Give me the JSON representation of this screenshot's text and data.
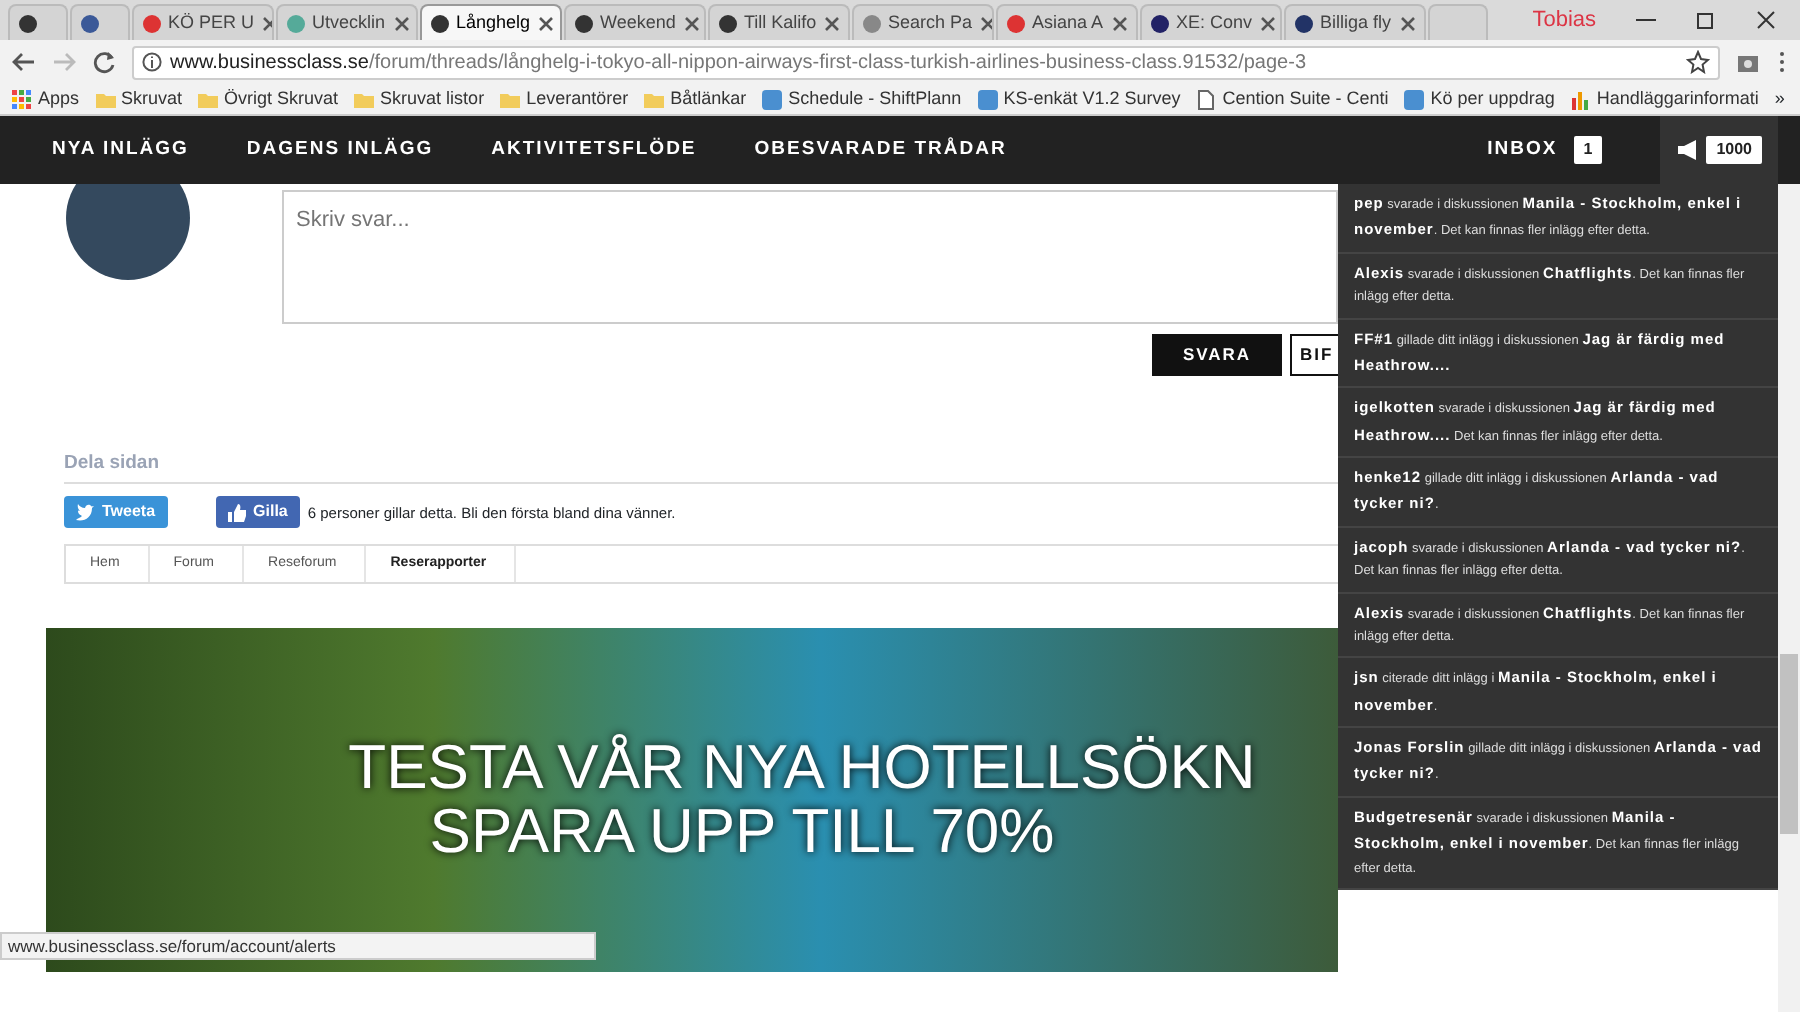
{
  "browser": {
    "tabs": [
      {
        "selected": false
      },
      {
        "selected": false
      },
      {
        "title": "KÖ PER U",
        "selected": false
      },
      {
        "title": "Utvecklin",
        "selected": false
      },
      {
        "title": "Långhelg",
        "selected": true
      },
      {
        "title": "Weekend",
        "selected": false
      },
      {
        "title": "Till Kalifo",
        "selected": false
      },
      {
        "title": "Search Pa",
        "selected": false
      },
      {
        "title": "Asiana A",
        "selected": false
      },
      {
        "title": "XE: Conv",
        "selected": false
      },
      {
        "title": "Billiga fly",
        "selected": false
      }
    ],
    "profile": "Tobias",
    "address": {
      "host": "www.businessclass.se",
      "path": "/forum/threads/långhelg-i-tokyo-all-nippon-airways-first-class-turkish-airlines-business-class.91532/page-3"
    },
    "bookmarks": [
      {
        "label": "Apps",
        "kind": "apps"
      },
      {
        "label": "Skruvat",
        "kind": "folder"
      },
      {
        "label": "Övrigt Skruvat",
        "kind": "folder"
      },
      {
        "label": "Skruvat listor",
        "kind": "folder"
      },
      {
        "label": "Leverantörer",
        "kind": "folder"
      },
      {
        "label": "Båtlänkar",
        "kind": "folder"
      },
      {
        "label": "Schedule - ShiftPlann",
        "kind": "site"
      },
      {
        "label": "KS-enkät V1.2 Survey",
        "kind": "site"
      },
      {
        "label": "Cention Suite - Centi",
        "kind": "page"
      },
      {
        "label": "Kö per uppdrag",
        "kind": "site"
      },
      {
        "label": "Handläggarinformati",
        "kind": "chart"
      }
    ],
    "more_bookmarks": "»"
  },
  "navbar": {
    "items": [
      "NYA INLÄGG",
      "DAGENS INLÄGG",
      "AKTIVITETSFLÖDE",
      "OBESVARADE TRÅDAR"
    ],
    "inbox": {
      "label": "INBOX",
      "count": "1"
    },
    "alerts_count": "1000"
  },
  "reply": {
    "placeholder": "Skriv svar...",
    "buttons": [
      "SVARA",
      "BIF"
    ]
  },
  "share": {
    "title": "Dela sidan",
    "tweet": "Tweeta",
    "like": "Gilla",
    "like_text": "6 personer gillar detta. Bli den första bland dina vänner."
  },
  "breadcrumb": [
    {
      "label": "Hem",
      "selected": false
    },
    {
      "label": "Forum",
      "selected": false
    },
    {
      "label": "Reseforum",
      "selected": false
    },
    {
      "label": "Reserapporter",
      "selected": true
    }
  ],
  "banner": {
    "lines": [
      "TESTA VÅR NYA HOTELLSÖKN",
      "SPARA UPP TILL 70%"
    ]
  },
  "alerts": [
    "**pep** svarade i diskussionen **Manila - Stockholm, enkel i november**. Det kan finnas fler inlägg efter detta.",
    "**Alexis** svarade i diskussionen **Chatflights**. Det kan finnas fler inlägg efter detta.",
    "**FF#1** gillade ditt inlägg i diskussionen **Jag är färdig med Heathrow....**",
    "**igelkotten** svarade i diskussionen **Jag är färdig med Heathrow....** Det kan finnas fler inlägg efter detta.",
    "**henke12** gillade ditt inlägg i diskussionen **Arlanda - vad tycker ni?**.",
    "**jacoph** svarade i diskussionen **Arlanda - vad tycker ni?**. Det kan finnas fler inlägg efter detta.",
    "**Alexis** svarade i diskussionen **Chatflights**. Det kan finnas fler inlägg efter detta.",
    "**jsn** citerade ditt inlägg i **Manila - Stockholm, enkel i november**.",
    "**Jonas Forslin** gillade ditt inlägg i diskussionen **Arlanda - vad tycker ni?**.",
    "**Budgetresenär** svarade i diskussionen **Manila - Stockholm, enkel i november**. Det kan finnas fler inlägg efter detta."
  ],
  "status_url": "www.businessclass.se/forum/account/alerts"
}
